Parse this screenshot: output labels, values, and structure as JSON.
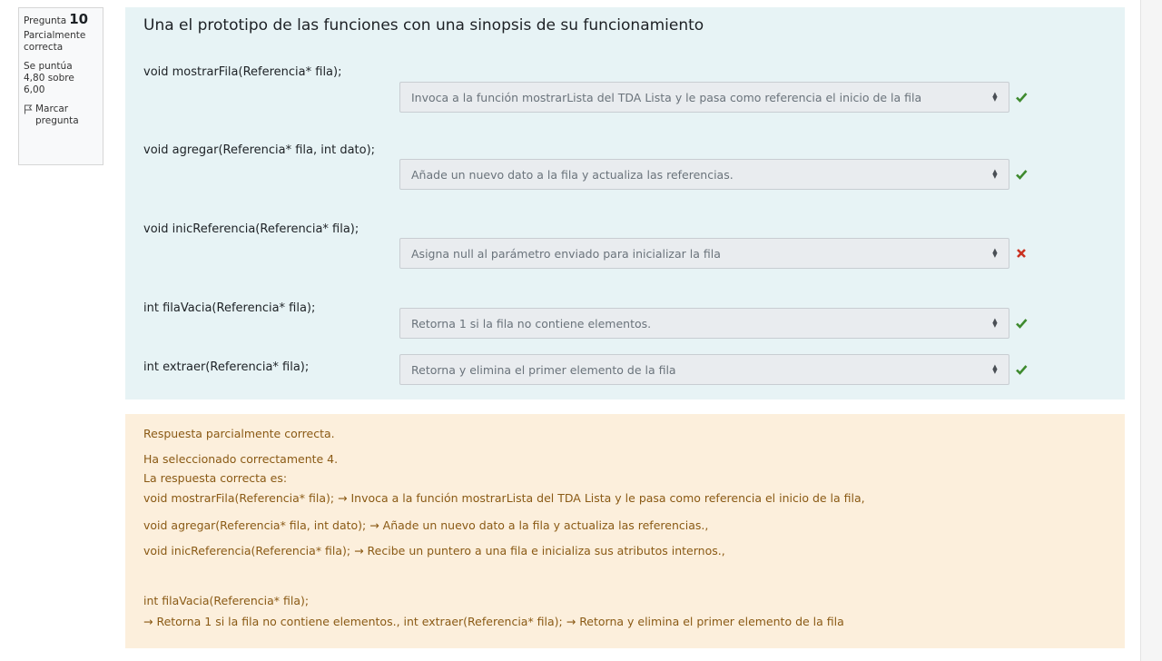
{
  "info": {
    "question_word": "Pregunta",
    "question_number": "10",
    "state_line1": "Parcialmente",
    "state_line2": "correcta",
    "grade_line1": "Se puntúa",
    "grade_line2": "4,80 sobre",
    "grade_line3": "6,00",
    "flag_line1": "Marcar",
    "flag_line2": "pregunta"
  },
  "question": {
    "text": "Una el prototipo de las funciones con una sinopsis de su funcionamiento",
    "items": [
      {
        "prototype": "void mostrarFila(Referencia* fila);",
        "selected": "Invoca a la función mostrarLista del TDA Lista y le pasa como referencia el inicio de la fila",
        "status": "correct"
      },
      {
        "prototype": "void agregar(Referencia* fila, int dato);",
        "selected": "Añade un nuevo dato a la fila y actualiza las referencias.",
        "status": "correct"
      },
      {
        "prototype": "void inicReferencia(Referencia* fila);",
        "selected": "Asigna null al parámetro enviado para inicializar la fila",
        "status": "incorrect"
      },
      {
        "prototype": "int filaVacia(Referencia* fila);",
        "selected": "Retorna 1 si la fila no contiene elementos.",
        "status": "correct"
      },
      {
        "prototype": "int extraer(Referencia* fila);",
        "selected": "Retorna y elimina el primer elemento de la fila",
        "status": "correct"
      }
    ]
  },
  "feedback": {
    "line1": "Respuesta parcialmente correcta.",
    "line2": "Ha seleccionado correctamente 4.",
    "line3": "La respuesta correcta es:",
    "line4": "void mostrarFila(Referencia* fila); → Invoca a la función mostrarLista del TDA Lista y le pasa como referencia el inicio de la fila,",
    "line5": "void agregar(Referencia* fila, int dato); → Añade un nuevo dato a la fila y actualiza las referencias.,",
    "line6": "void inicReferencia(Referencia* fila); → Recibe un puntero a una fila e inicializa sus atributos internos.,",
    "line7": "int filaVacia(Referencia* fila);",
    "line8": "→ Retorna 1 si la fila no contiene elementos., int extraer(Referencia* fila); → Retorna y elimina el primer elemento de la fila"
  },
  "colors": {
    "correct": "#3e8a2e",
    "incorrect": "#ca3120",
    "content_bg": "#e7f3f5",
    "feedback_bg": "#fcefdc",
    "feedback_text": "#8a5a15"
  }
}
